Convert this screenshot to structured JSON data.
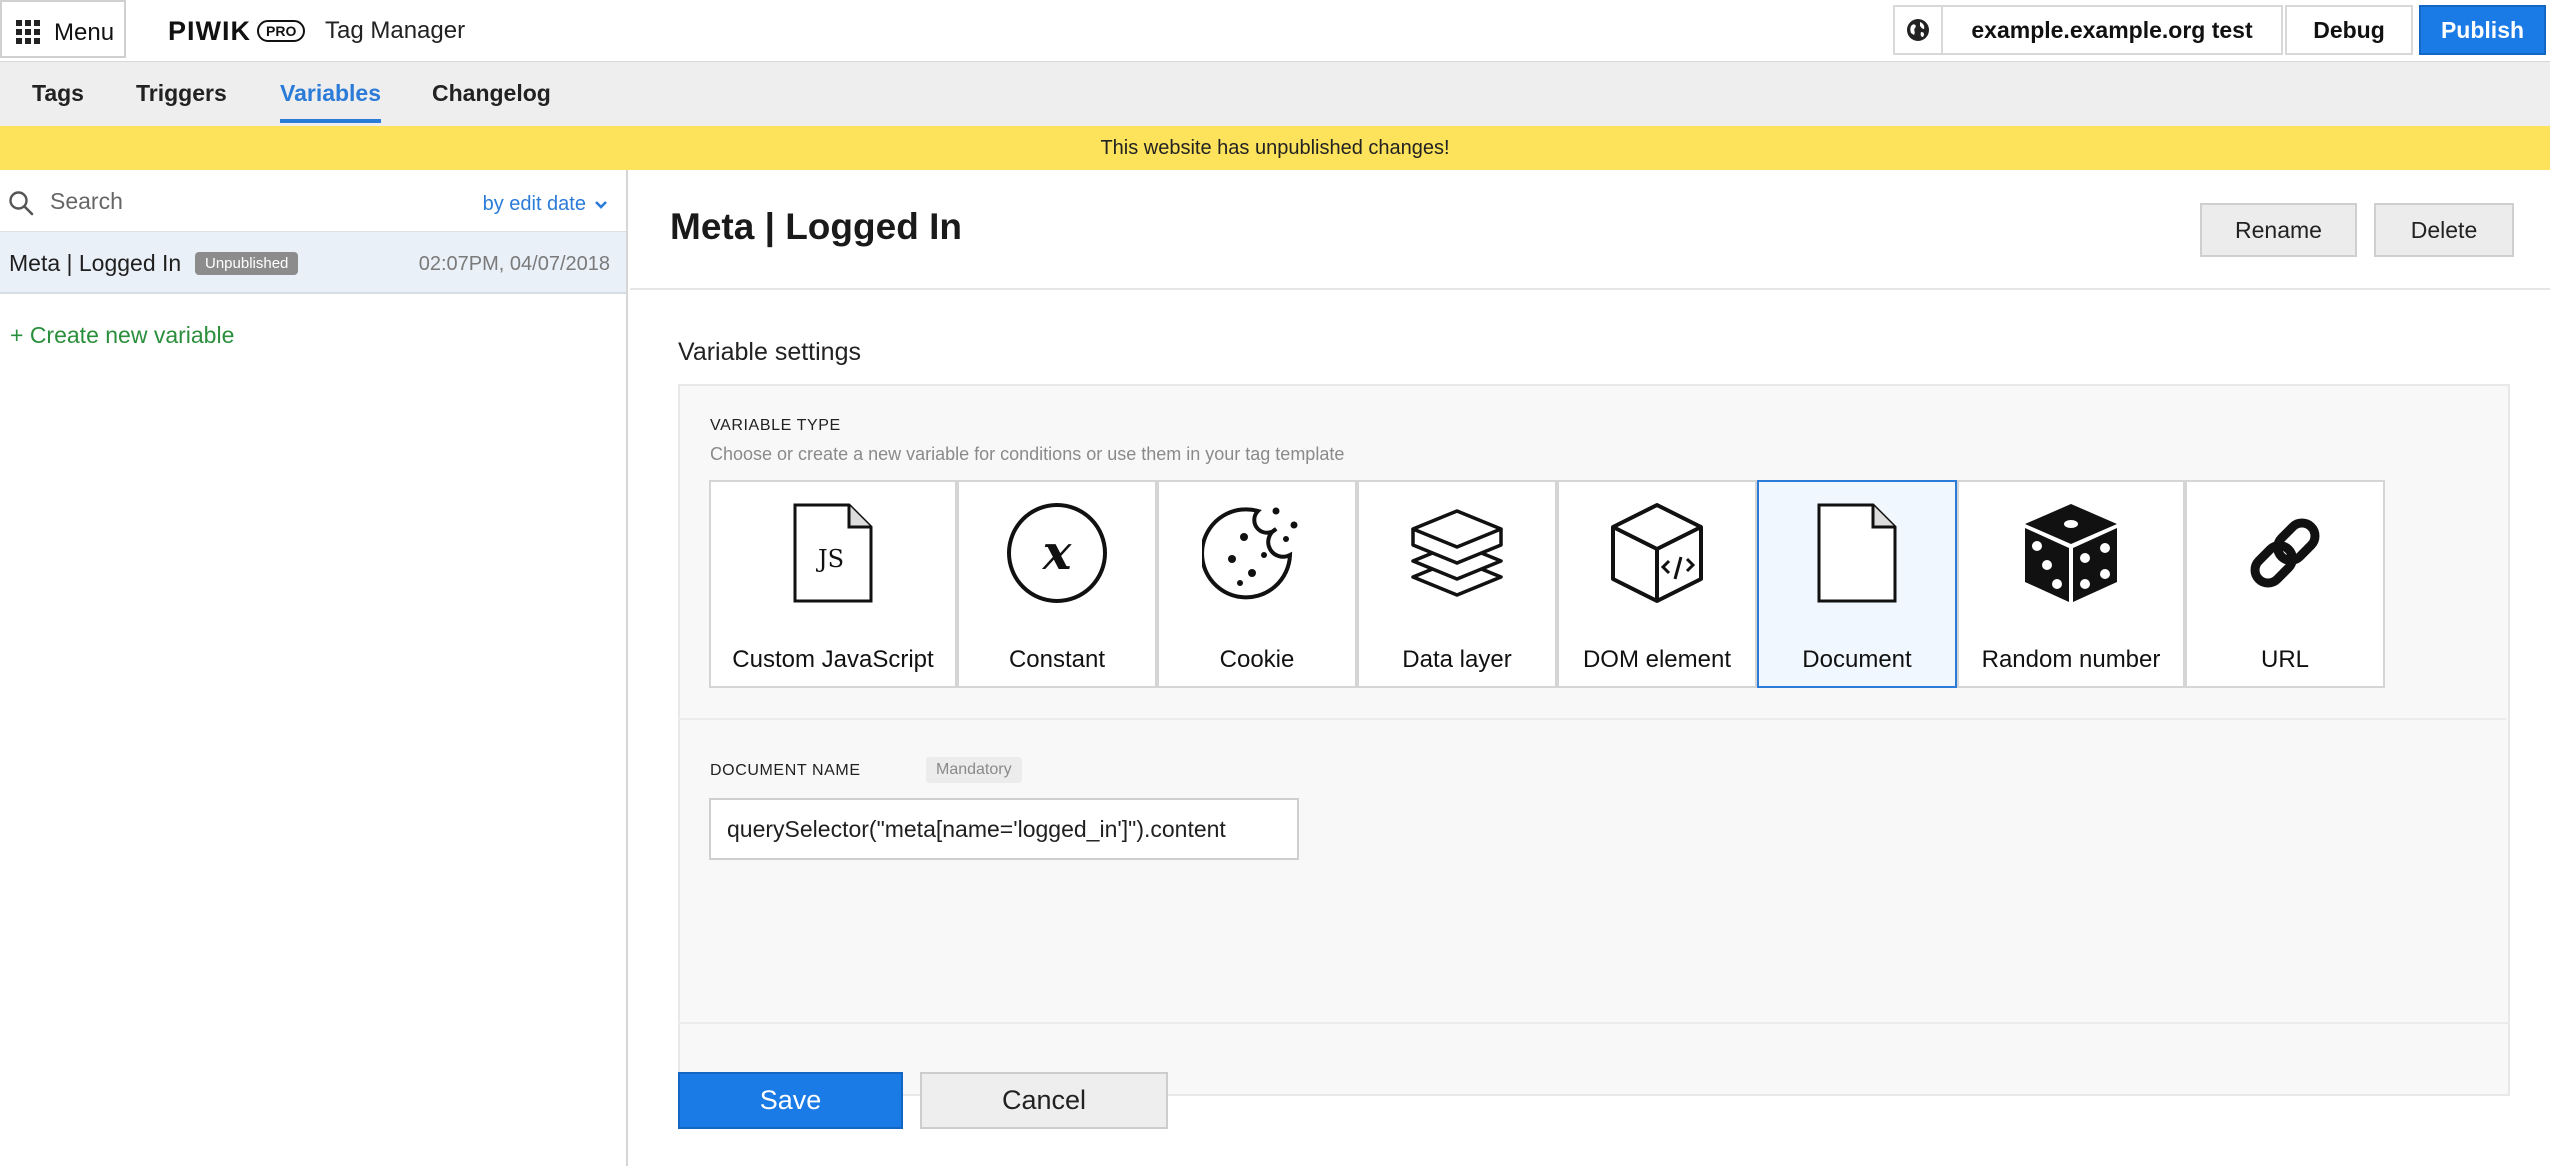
{
  "topbar": {
    "menu_label": "Menu",
    "logo_text": "PIWIK",
    "logo_badge": "PRO",
    "app_title": "Tag Manager",
    "site_name": "example.example.org test",
    "debug_label": "Debug",
    "publish_label": "Publish"
  },
  "nav": {
    "tabs": [
      {
        "label": "Tags",
        "active": false
      },
      {
        "label": "Triggers",
        "active": false
      },
      {
        "label": "Variables",
        "active": true
      },
      {
        "label": "Changelog",
        "active": false
      }
    ]
  },
  "banner": {
    "text": "This website has unpublished changes!"
  },
  "sidebar": {
    "search_placeholder": "Search",
    "sort_label": "by edit date",
    "items": [
      {
        "name": "Meta | Logged In",
        "badge": "Unpublished",
        "date": "02:07PM, 04/07/2018"
      }
    ],
    "create_label": "+ Create new variable"
  },
  "main": {
    "title": "Meta | Logged In",
    "rename_label": "Rename",
    "delete_label": "Delete",
    "section_title": "Variable settings",
    "variable_type": {
      "label": "VARIABLE TYPE",
      "hint": "Choose or create a new variable for conditions or use them in your tag template",
      "selected": "Document",
      "options": [
        {
          "label": "Custom JavaScript",
          "icon": "js-file-icon"
        },
        {
          "label": "Constant",
          "icon": "constant-x-icon"
        },
        {
          "label": "Cookie",
          "icon": "cookie-icon"
        },
        {
          "label": "Data layer",
          "icon": "layers-icon"
        },
        {
          "label": "DOM element",
          "icon": "cube-code-icon"
        },
        {
          "label": "Document",
          "icon": "document-icon"
        },
        {
          "label": "Random number",
          "icon": "dice-icon"
        },
        {
          "label": "URL",
          "icon": "link-icon"
        }
      ]
    },
    "document_name": {
      "label": "DOCUMENT NAME",
      "badge": "Mandatory",
      "value": "querySelector(\"meta[name='logged_in']\").content"
    },
    "save_label": "Save",
    "cancel_label": "Cancel"
  },
  "colors": {
    "accent": "#1a7ae6",
    "banner": "#fde25c",
    "link_green": "#2a8f3c",
    "selected_tile_bg": "#f0f7fe"
  }
}
